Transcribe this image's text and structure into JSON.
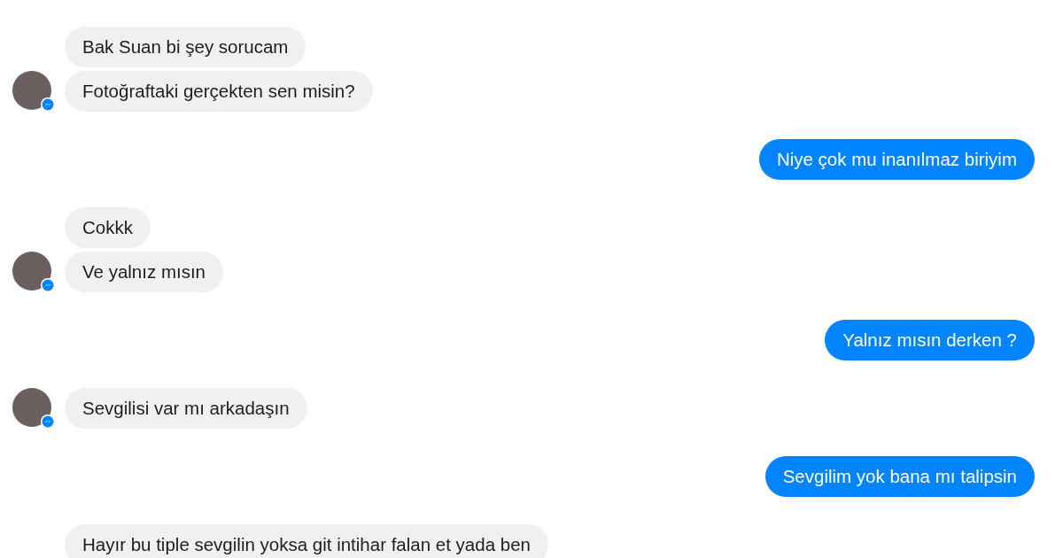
{
  "conversation": [
    {
      "kind": "incoming",
      "avatar": true,
      "messages": [
        "Bak Suan bi şey sorucam",
        "Fotoğraftaki gerçekten sen misin?"
      ]
    },
    {
      "kind": "outgoing",
      "messages": [
        "Niye çok mu inanılmaz biriyim"
      ]
    },
    {
      "kind": "incoming",
      "avatar": true,
      "messages": [
        "Cokkk",
        "Ve yalnız mısın"
      ]
    },
    {
      "kind": "outgoing",
      "messages": [
        "Yalnız mısın derken ?"
      ]
    },
    {
      "kind": "incoming",
      "avatar": true,
      "messages": [
        "Sevgilisi var mı arkadaşın"
      ]
    },
    {
      "kind": "outgoing",
      "messages": [
        "Sevgilim yok bana mı talipsin"
      ]
    },
    {
      "kind": "incoming",
      "avatar": false,
      "messages": [
        "Hayır bu tiple sevgilin yoksa git intihar falan et yada ben"
      ]
    }
  ]
}
